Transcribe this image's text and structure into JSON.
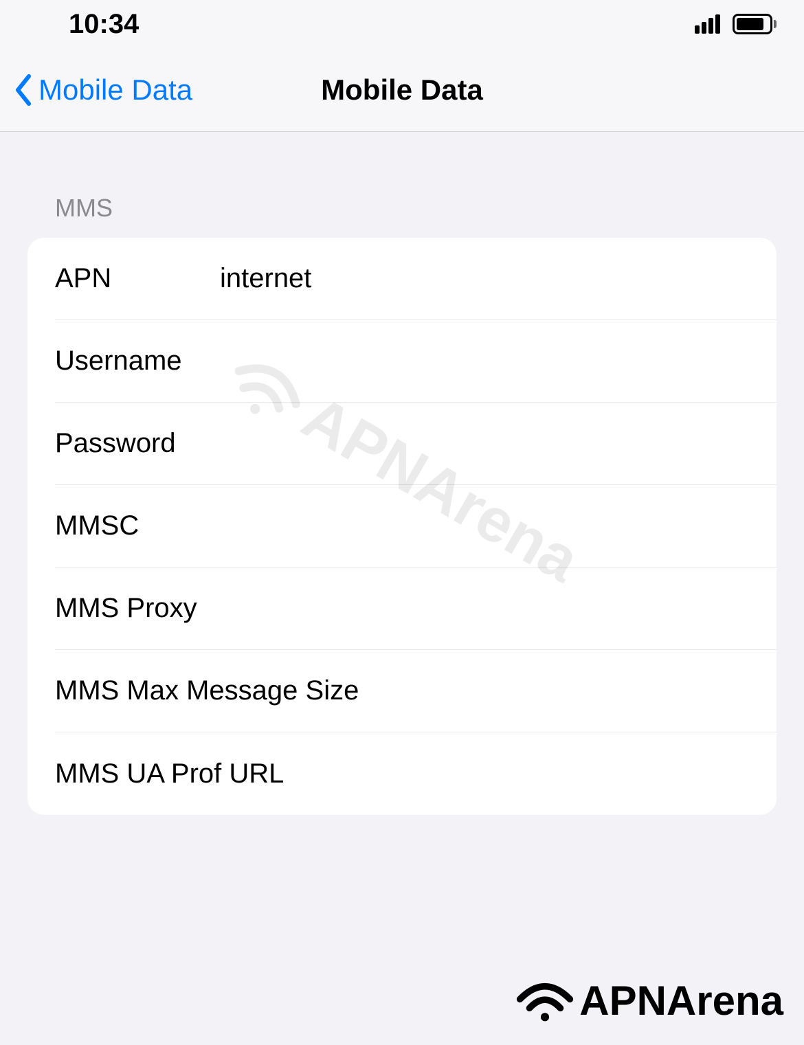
{
  "status_bar": {
    "time": "10:34"
  },
  "nav": {
    "back_label": "Mobile Data",
    "title": "Mobile Data"
  },
  "section": {
    "header": "MMS"
  },
  "fields": {
    "apn": {
      "label": "APN",
      "value": "internet"
    },
    "username": {
      "label": "Username",
      "value": ""
    },
    "password": {
      "label": "Password",
      "value": ""
    },
    "mmsc": {
      "label": "MMSC",
      "value": ""
    },
    "mms_proxy": {
      "label": "MMS Proxy",
      "value": ""
    },
    "mms_max_size": {
      "label": "MMS Max Message Size",
      "value": ""
    },
    "mms_ua_prof": {
      "label": "MMS UA Prof URL",
      "value": ""
    }
  },
  "watermark": {
    "text": "APNArena"
  },
  "footer": {
    "text": "APNArena"
  }
}
